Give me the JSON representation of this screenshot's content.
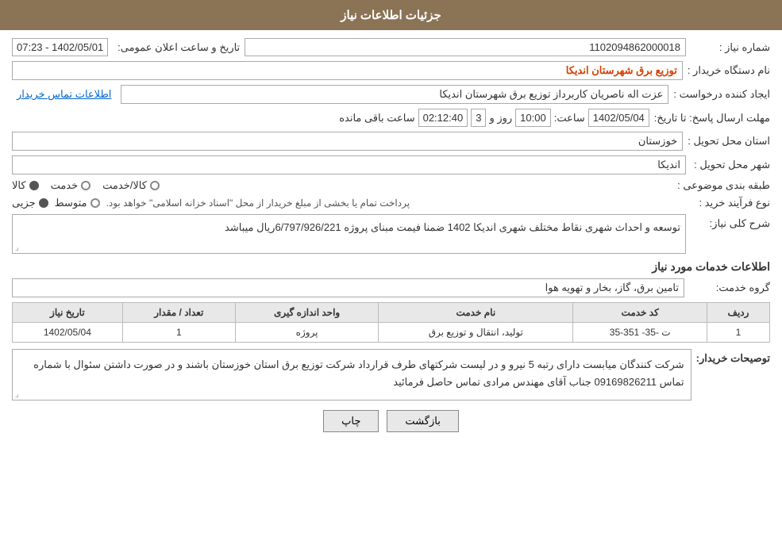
{
  "header": {
    "title": "جزئیات اطلاعات نیاز"
  },
  "fields": {
    "need_number_label": "شماره نیاز :",
    "need_number_value": "1102094862000018",
    "buyer_org_label": "نام دستگاه خریدار :",
    "buyer_org_value": "توزیع برق شهرستان اندیکا",
    "creator_label": "ایجاد کننده درخواست :",
    "creator_value": "عزت اله ناصریان کاربرداز توزیع برق شهرستان اندیکا",
    "contact_link": "اطلاعات تماس خریدار",
    "deadline_label": "مهلت ارسال پاسخ: تا تاریخ:",
    "deadline_date": "1402/05/04",
    "deadline_time_label": "ساعت:",
    "deadline_time": "10:00",
    "deadline_days_label": "روز و",
    "deadline_days": "3",
    "deadline_remaining_label": "ساعت باقی مانده",
    "deadline_remaining": "02:12:40",
    "announce_label": "تاریخ و ساعت اعلان عمومی:",
    "announce_value": "1402/05/01 - 07:23",
    "province_label": "استان محل تحویل :",
    "province_value": "خوزستان",
    "city_label": "شهر محل تحویل :",
    "city_value": "اندیکا",
    "category_label": "طبقه بندی موضوعی :",
    "category_kala": "کالا",
    "category_khadamat": "خدمت",
    "category_kala_khadamat": "کالا/خدمت",
    "process_label": "نوع فرآیند خرید :",
    "process_jozi": "جزیی",
    "process_motavaset": "متوسط",
    "process_note": "پرداخت تمام یا بخشی از مبلغ خریدار از محل \"اسناد خزانه اسلامی\" خواهد بود.",
    "description_label": "شرح کلی نیاز:",
    "description_value": "توسعه و احداث شهری نقاط مختلف شهری اندیکا 1402 ضمنا فیمت مبنای پروژه 6/797/926/221ریال میباشد",
    "services_section_label": "اطلاعات خدمات مورد نیاز",
    "service_group_label": "گروه خدمت:",
    "service_group_value": "تامین برق، گاز، بخار و تهویه هوا",
    "table": {
      "headers": [
        "ردیف",
        "کد خدمت",
        "نام خدمت",
        "واحد اندازه گیری",
        "تعداد / مقدار",
        "تاریخ نیاز"
      ],
      "rows": [
        [
          "1",
          "ت -35- 351-35",
          "تولید، انتقال و توزیع برق",
          "پروژه",
          "1",
          "1402/05/04"
        ]
      ]
    },
    "buyer_notes_label": "توصیحات خریدار:",
    "buyer_notes_value": "شرکت کنندگان میابست دارای رتبه 5 نیرو  و در لیست شرکتهای طرف قرارداد شرکت توزیع برق استان خوزستان باشند و در صورت داشتن سئوال با شماره تماس 09169826211 جناب آقای مهندس مرادی تماس حاصل فرمائید",
    "btn_back": "بازگشت",
    "btn_print": "چاپ"
  }
}
